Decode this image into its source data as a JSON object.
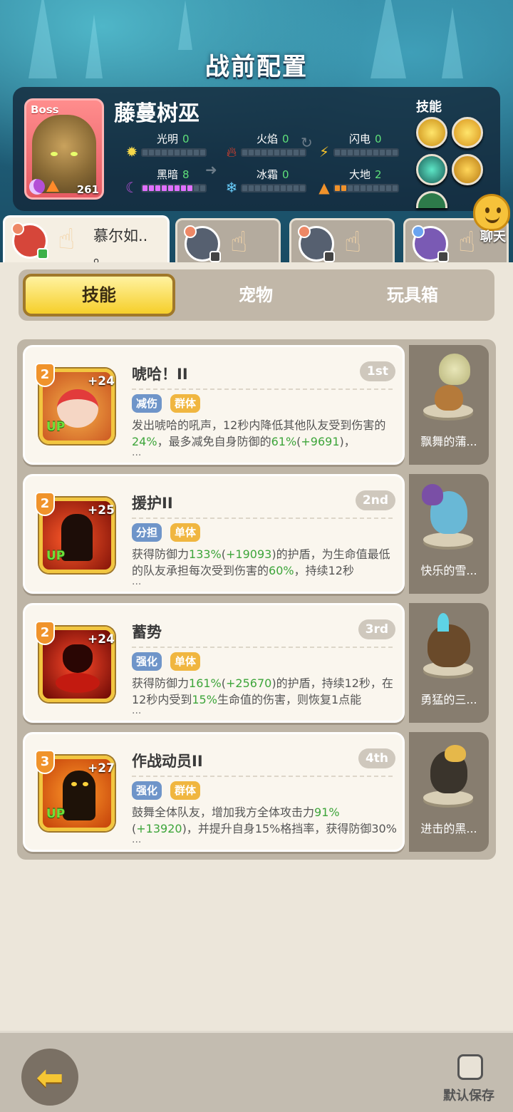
{
  "header": {
    "title": "战前配置"
  },
  "boss": {
    "tag": "Boss",
    "name": "藤蔓树巫",
    "level": "261",
    "elements": [
      {
        "name": "光明",
        "value": "0",
        "icon": "sun-icon",
        "fill": 0,
        "color": "#f6d84a"
      },
      {
        "name": "火焰",
        "value": "0",
        "icon": "flame-icon",
        "fill": 0,
        "color": "#e6402c"
      },
      {
        "name": "闪电",
        "value": "0",
        "icon": "lightning-icon",
        "fill": 0,
        "color": "#f6c22a"
      },
      {
        "name": "黑暗",
        "value": "8",
        "icon": "moon-icon",
        "fill": 8,
        "color": "#e070ff"
      },
      {
        "name": "冰霜",
        "value": "0",
        "icon": "snowflake-icon",
        "fill": 0,
        "color": "#6ad0ff"
      },
      {
        "name": "大地",
        "value": "2",
        "icon": "mountain-icon",
        "fill": 2,
        "color": "#f0922b"
      }
    ],
    "skills_label": "技能"
  },
  "team": {
    "slots": [
      {
        "name": "慕尔如..",
        "sub": "。",
        "active": true
      },
      {
        "name": "",
        "active": false
      },
      {
        "name": "",
        "active": false
      },
      {
        "name": "",
        "active": false
      }
    ],
    "chat_label": "聊天"
  },
  "tabs": [
    {
      "label": "技能",
      "active": true
    },
    {
      "label": "宠物",
      "active": false
    },
    {
      "label": "玩具箱",
      "active": false
    }
  ],
  "skills": [
    {
      "level": "2",
      "plus": "+24",
      "up": "UP",
      "title": "唬哈！II",
      "rank": "1st",
      "tags": [
        "减伤",
        "群体"
      ],
      "desc_parts": [
        "发出唬哈的吼声，12秒内降低其他队友受到伤害的",
        "24%",
        "，最多减免自身防御的",
        "61%",
        "(",
        "+9691",
        ")，"
      ],
      "pet": "飘舞的蒲..."
    },
    {
      "level": "2",
      "plus": "+25",
      "up": "UP",
      "title": "援护II",
      "rank": "2nd",
      "tags": [
        "分担",
        "单体"
      ],
      "desc_parts": [
        "获得防御力",
        "133%",
        "(",
        "+19093",
        ")的护盾，为生命值最低的队友承担每次受到伤害的",
        "60%",
        "，持续12秒",
        "",
        ""
      ],
      "pet": "快乐的雪..."
    },
    {
      "level": "2",
      "plus": "+24",
      "up": "",
      "title": "蓄势",
      "rank": "3rd",
      "tags": [
        "强化",
        "单体"
      ],
      "desc_parts": [
        "获得防御力",
        "161%",
        "(",
        "+25670",
        ")的护盾，持续12秒，在12秒内受到",
        "15%",
        "生命值的伤害，则恢复1点能",
        "",
        ""
      ],
      "pet": "勇猛的三..."
    },
    {
      "level": "3",
      "plus": "+27",
      "up": "UP",
      "title": "作战动员II",
      "rank": "4th",
      "tags": [
        "强化",
        "群体"
      ],
      "desc_parts": [
        "鼓舞全体队友，增加我方全体攻击力",
        "91%",
        "(",
        "+13920",
        ")，并提升自身15%格挡率，获得防御30%的",
        "",
        "",
        "",
        ""
      ],
      "pet": "进击的黑..."
    }
  ],
  "ellipsis": "...",
  "bottom": {
    "save_label": "默认保存"
  },
  "colors": {
    "accent": "#f6cf2a",
    "green": "#3da53a",
    "tag_blue": "#6f95c9",
    "tag_orange": "#f0b640"
  }
}
